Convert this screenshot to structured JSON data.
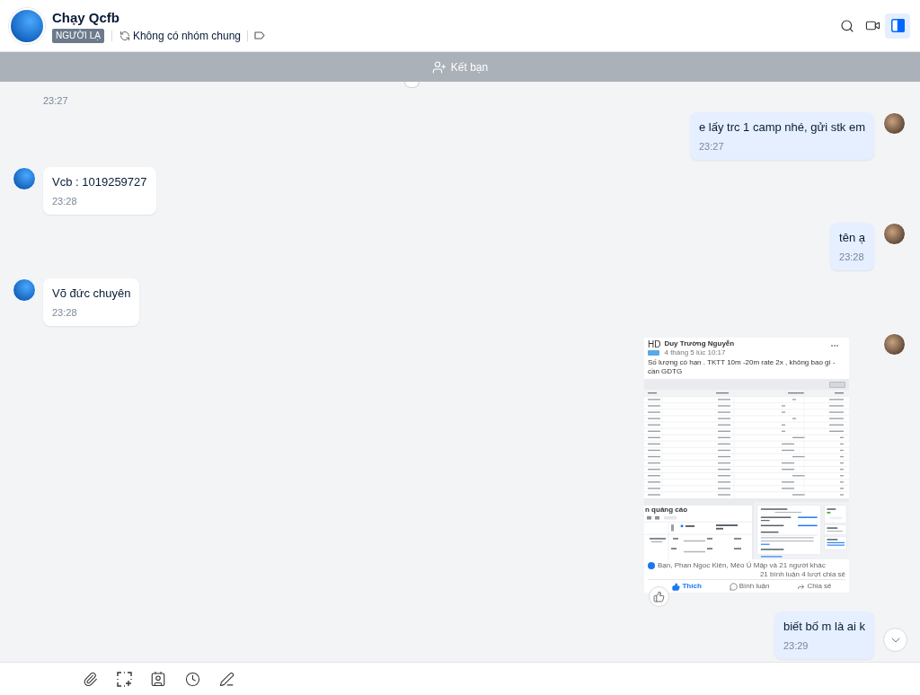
{
  "header": {
    "title": "Chạy Qcfb",
    "badge": "NGƯỜI LẠ",
    "common_groups": "Không có nhóm chung",
    "info_panel_open": true
  },
  "friend_banner": {
    "label": "Kết bạn"
  },
  "messages": [
    {
      "kind": "time_only",
      "outgoing": false,
      "avatar": false,
      "reaction_button": true,
      "time": "23:27"
    },
    {
      "kind": "text",
      "outgoing": true,
      "avatar": true,
      "text": "e lấy trc 1 camp nhé, gửi stk em",
      "time": "23:27"
    },
    {
      "kind": "text",
      "outgoing": false,
      "avatar": true,
      "text": "Vcb : 1019259727",
      "time": "23:28"
    },
    {
      "kind": "text",
      "outgoing": true,
      "avatar": true,
      "text": "tên ạ",
      "time": "23:28"
    },
    {
      "kind": "text",
      "outgoing": false,
      "avatar": true,
      "text": "Võ đức chuyên",
      "time": "23:28"
    },
    {
      "kind": "image",
      "outgoing": true,
      "avatar": true,
      "reaction_button": true,
      "post": {
        "initials": "HD",
        "author": "Duy Trường Nguyễn",
        "date": "4 tháng 5 lúc 10:17",
        "caption": "Số lượng có hạn . TKTT 10m -20m rate 2x , không bao gì - cần GDTG",
        "section": "n quảng cáo",
        "reactions": "Bạn, Phan Ngọc Kiên, Mèo Ú Mập và 21 người khác",
        "counts": "21 bình luận 4 lượt chia sẻ",
        "actions": [
          {
            "kind": "like",
            "label": "Thích",
            "selected": true
          },
          {
            "kind": "comment",
            "label": "Bình luận",
            "selected": false
          },
          {
            "kind": "share",
            "label": "Chia sẻ",
            "selected": false
          }
        ]
      }
    },
    {
      "kind": "text",
      "outgoing": true,
      "avatar": false,
      "text": "biết bố m là ai k",
      "time": "23:29"
    }
  ]
}
